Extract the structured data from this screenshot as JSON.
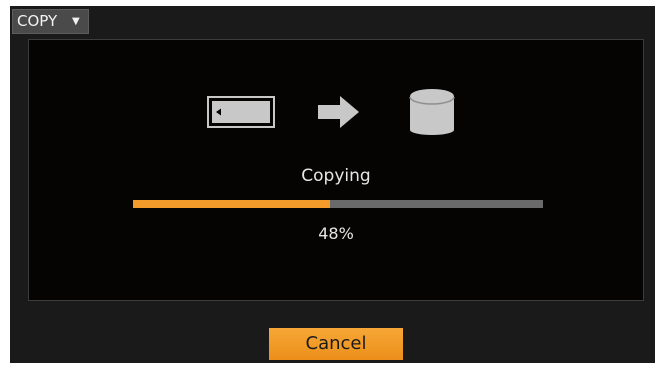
{
  "header": {
    "mode_label": "COPY",
    "mode_caret": "▼"
  },
  "copy_panel": {
    "source_icon": "memory-card-icon",
    "direction_icon": "arrow-right-icon",
    "destination_icon": "storage-drive-icon",
    "status_text": "Copying",
    "progress_percent": 48,
    "progress_text": "48%"
  },
  "actions": {
    "cancel_label": "Cancel"
  },
  "colors": {
    "accent": "#f29a2a",
    "track": "#6a6a6a",
    "icon": "#c8c8c8"
  }
}
